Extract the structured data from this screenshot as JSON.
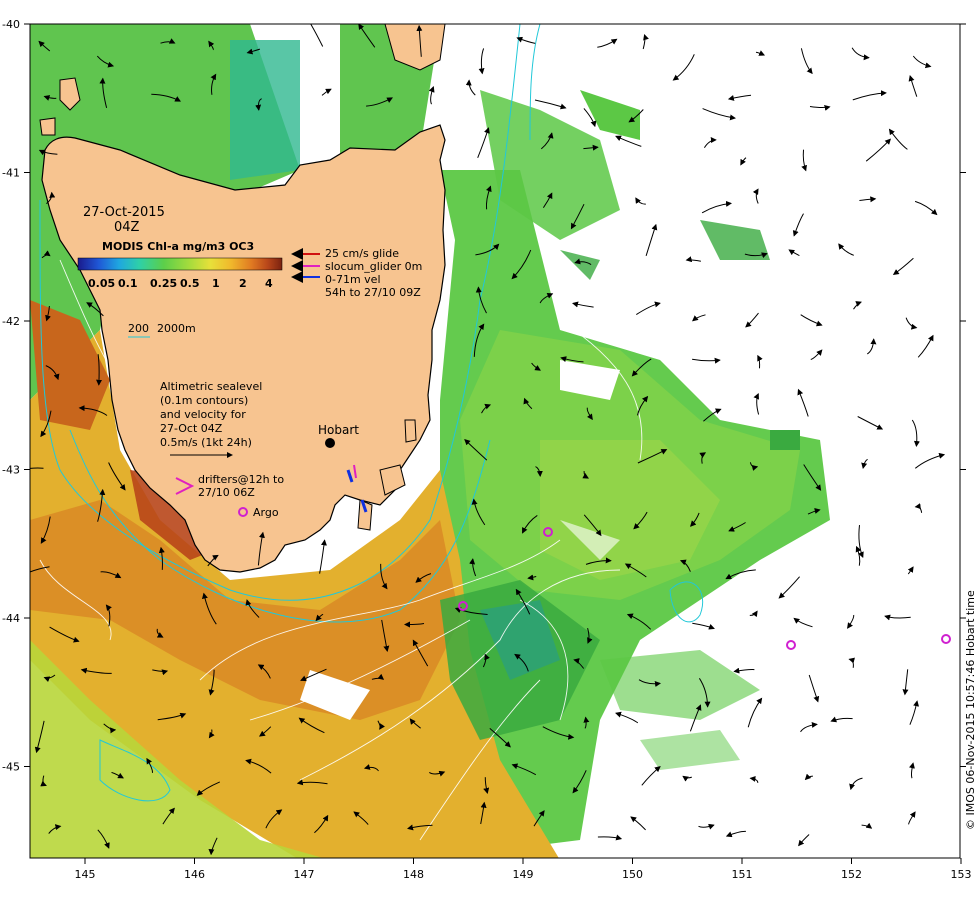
{
  "map": {
    "date": "27-Oct-2015",
    "time": "04Z",
    "colorbar": {
      "title": "MODIS Chl-a mg/m3 OC3",
      "ticks": [
        "0.05",
        "0.1",
        "0.25",
        "0.5",
        "1",
        "2",
        "4"
      ],
      "colors": [
        "#1a1a8c",
        "#1f57d6",
        "#1fa6e0",
        "#2ed0a8",
        "#5ccf4a",
        "#a8dc3c",
        "#e8e03a",
        "#f0b82c",
        "#e07a22",
        "#b8461a",
        "#7a2210"
      ]
    },
    "legend_right": {
      "glide": "25 cm/s glide",
      "glider": "slocum_glider 0m",
      "vel": "0-71m vel",
      "time": "54h to 27/10 09Z"
    },
    "depth_legend": {
      "a": "200",
      "b": "2000m"
    },
    "sealevel": {
      "line1": "Altimetric sealevel",
      "line2": "(0.1m contours)",
      "line3": "and velocity for",
      "line4": "27-Oct 04Z",
      "line5": "0.5m/s (1kt 24h)"
    },
    "drifters": {
      "line1": "drifters@12h to",
      "line2": "27/10 06Z"
    },
    "argo_label": "Argo",
    "city_label": "Hobart",
    "x_ticks": [
      "145",
      "146",
      "147",
      "148",
      "149",
      "150",
      "151",
      "152",
      "153"
    ],
    "y_ticks": [
      "-40",
      "-41",
      "-42",
      "-43",
      "-44",
      "-45"
    ],
    "credit": "© IMOS 06-Nov-2015 10:57:46 Hobart time",
    "colors": {
      "land": "#f7c490",
      "depth": "#22c8d8",
      "argo": "#d020d0",
      "glider_red": "#d01010",
      "glider_magenta": "#e020c0",
      "glider_blue": "#1030e0"
    }
  }
}
